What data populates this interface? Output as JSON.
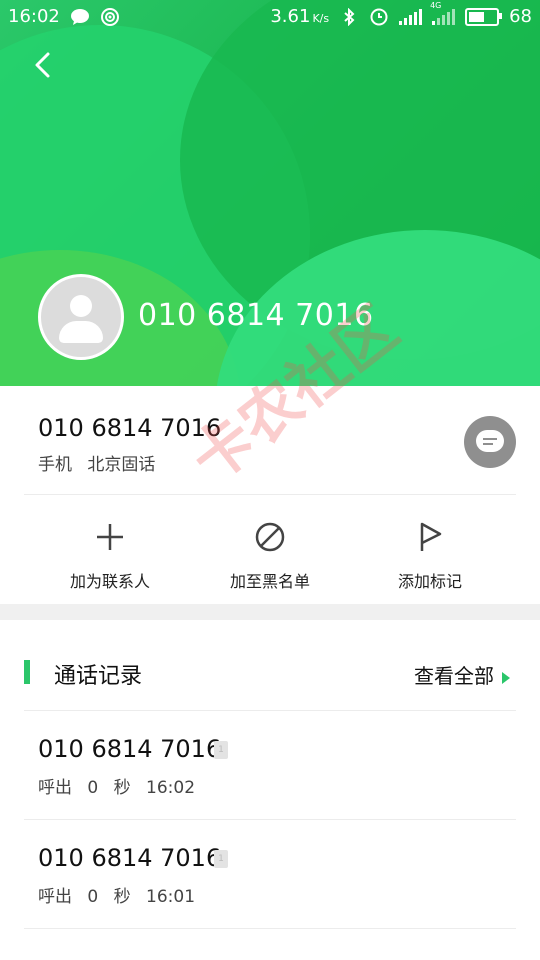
{
  "status_bar": {
    "time": "16:02",
    "speed": "3.61",
    "speed_unit": "K/s",
    "signal_label": "4G",
    "battery": "68",
    "battery_level": 0.68
  },
  "header": {
    "hero_number": "010 6814 7016"
  },
  "contact": {
    "number": "010 6814 7016",
    "type": "手机",
    "location": "北京固话"
  },
  "actions": [
    {
      "label": "加为联系人",
      "icon": "plus-icon"
    },
    {
      "label": "加至黑名单",
      "icon": "block-icon"
    },
    {
      "label": "添加标记",
      "icon": "flag-icon"
    }
  ],
  "call_log": {
    "title": "通话记录",
    "view_all": "查看全部",
    "sim": "1",
    "records": [
      {
        "number": "010 6814 7016",
        "direction": "呼出",
        "duration": "0 秒",
        "time": "16:02"
      },
      {
        "number": "010 6814 7016",
        "direction": "呼出",
        "duration": "0 秒",
        "time": "16:01"
      }
    ]
  },
  "watermark": "卡农社区",
  "colors": {
    "accent": "#2bc66a",
    "header_green": "#17b34a"
  }
}
